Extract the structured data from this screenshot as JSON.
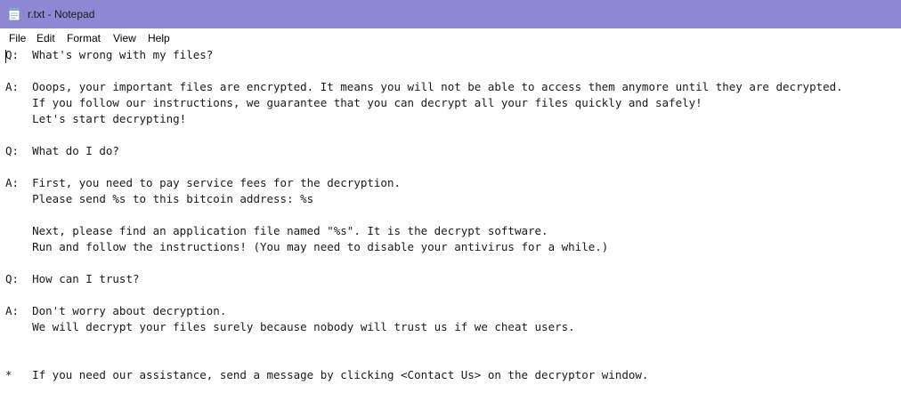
{
  "window": {
    "title": "r.txt - Notepad",
    "icon": "notepad-icon",
    "titlebar_color": "#8e88d4"
  },
  "menu": {
    "file": "File",
    "edit": "Edit",
    "format": "Format",
    "view": "View",
    "help": "Help"
  },
  "document": {
    "lines": [
      "Q:  What's wrong with my files?",
      "",
      "A:  Ooops, your important files are encrypted. It means you will not be able to access them anymore until they are decrypted.",
      "    If you follow our instructions, we guarantee that you can decrypt all your files quickly and safely!",
      "    Let's start decrypting!",
      "",
      "Q:  What do I do?",
      "",
      "A:  First, you need to pay service fees for the decryption.",
      "    Please send %s to this bitcoin address: %s",
      "",
      "    Next, please find an application file named \"%s\". It is the decrypt software.",
      "    Run and follow the instructions! (You may need to disable your antivirus for a while.)",
      "",
      "Q:  How can I trust?",
      "",
      "A:  Don't worry about decryption.",
      "    We will decrypt your files surely because nobody will trust us if we cheat users.",
      "",
      "",
      "*   If you need our assistance, send a message by clicking <Contact Us> on the decryptor window."
    ]
  }
}
